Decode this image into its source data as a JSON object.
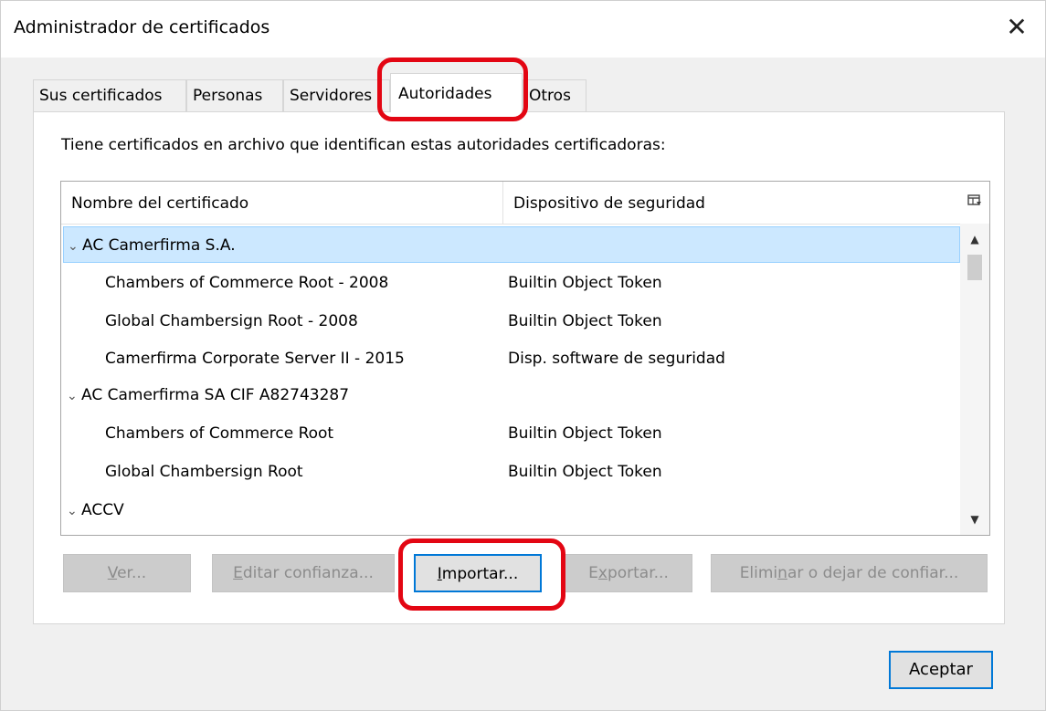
{
  "window": {
    "title": "Administrador de certificados",
    "close_glyph": "✕"
  },
  "tabs": [
    {
      "label": "Sus certificados"
    },
    {
      "label": "Personas"
    },
    {
      "label": "Servidores"
    },
    {
      "label": "Autoridades",
      "active": true
    },
    {
      "label": "Otros"
    }
  ],
  "intro": "Tiene certificados en archivo que identifican estas autoridades certificadoras:",
  "table": {
    "headers": [
      "Nombre del certificado",
      "Dispositivo de seguridad"
    ],
    "column_picker_icon": "column-picker-icon",
    "rows": [
      {
        "type": "group",
        "name": "AC Camerfirma S.A.",
        "device": "",
        "selected": true
      },
      {
        "type": "child",
        "name": "Chambers of Commerce Root - 2008",
        "device": "Builtin Object Token"
      },
      {
        "type": "child",
        "name": "Global Chambersign Root - 2008",
        "device": "Builtin Object Token"
      },
      {
        "type": "child",
        "name": "Camerfirma Corporate Server II - 2015",
        "device": "Disp. software de seguridad"
      },
      {
        "type": "group",
        "name": "AC Camerfirma SA CIF A82743287",
        "device": ""
      },
      {
        "type": "child",
        "name": "Chambers of Commerce Root",
        "device": "Builtin Object Token"
      },
      {
        "type": "child",
        "name": "Global Chambersign Root",
        "device": "Builtin Object Token"
      },
      {
        "type": "group",
        "name": "ACCV",
        "device": ""
      }
    ]
  },
  "buttons": {
    "ver": {
      "pre": "",
      "key": "V",
      "post": "er..."
    },
    "editar": {
      "pre": "",
      "key": "E",
      "post": "ditar confianza..."
    },
    "importar": {
      "pre": "",
      "key": "I",
      "post": "mportar..."
    },
    "exportar": {
      "pre": "E",
      "key": "x",
      "post": "portar..."
    },
    "eliminar": {
      "pre": "Elimi",
      "key": "n",
      "post": "ar o dejar de confiar..."
    }
  },
  "ok_label": "Aceptar",
  "highlight_color": "#e30613",
  "selection_color": "#cce8ff",
  "accent_color": "#0078d7"
}
